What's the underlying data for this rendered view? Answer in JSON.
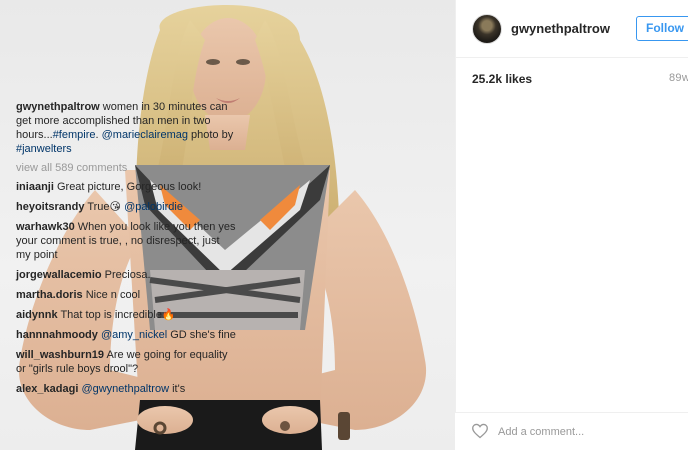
{
  "post": {
    "username": "gwynethpaltrow",
    "follow_label": "Follow",
    "likes": "25.2k likes",
    "time_ago": "89w"
  },
  "caption": {
    "user": "gwynethpaltrow",
    "text": "women in 30 minutes can get more accomplished than men in two hours...",
    "tags": [
      "#fempire",
      "@marieclairemag",
      "#janwelters"
    ],
    "mid": ". ",
    "photo_by": " photo by "
  },
  "view_all": "view all 589 comments",
  "comments": [
    {
      "user": "iniaanji",
      "text": "Great picture, Gorgeous look!"
    },
    {
      "user": "heyoitsrandy",
      "text": "True😘",
      "tag": "@palobirdie"
    },
    {
      "user": "warhawk30",
      "text": "When you look like you then yes your comment is true, , no disrespect, just my point"
    },
    {
      "user": "jorgewallacemio",
      "text": "Preciosa."
    },
    {
      "user": "martha.doris",
      "text": "Nice n cool"
    },
    {
      "user": "aidynnk",
      "text": "That top is incredible🔥"
    },
    {
      "user": "hannnahmoody",
      "tag": "@amy_nickel",
      "text": "GD she's fine"
    },
    {
      "user": "will_washburn19",
      "text": "Are we going for equality or \"girls rule boys drool\"?"
    },
    {
      "user": "alex_kadagi",
      "tag": "@gwynethpaltrow",
      "text": "it's"
    }
  ],
  "add_comment": {
    "placeholder": "Add a comment..."
  },
  "icons": {
    "heart": "heart-outline-icon",
    "avatar": "profile-avatar"
  },
  "colors": {
    "accent": "#3897f0",
    "tag": "#003569",
    "muted": "#999999"
  }
}
